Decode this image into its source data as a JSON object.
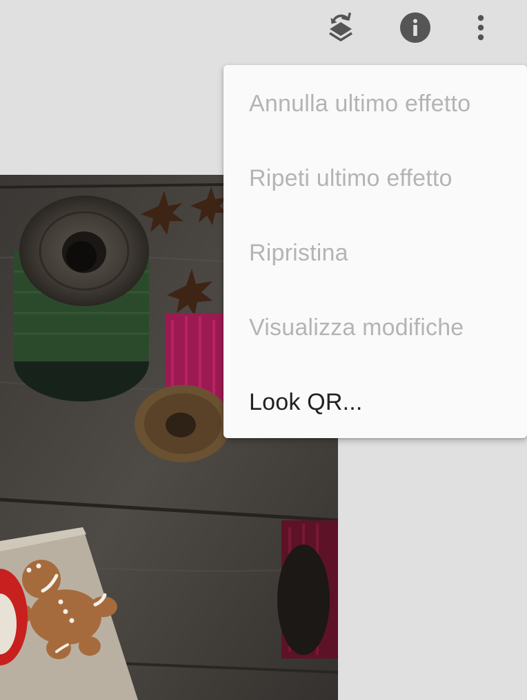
{
  "toolbar": {
    "stacks_icon": "layers-undo-icon",
    "info_icon": "info-icon",
    "more_icon": "more-vert-icon"
  },
  "photo": {
    "subject": "spools of thread, star anise and gingerbread man cookie on a dark wooden table"
  },
  "menu": {
    "items": [
      {
        "label": "Annulla ultimo effetto",
        "enabled": false
      },
      {
        "label": "Ripeti ultimo effetto",
        "enabled": false
      },
      {
        "label": "Ripristina",
        "enabled": false
      },
      {
        "label": "Visualizza modifiche",
        "enabled": false
      },
      {
        "label": "Look QR...",
        "enabled": true
      }
    ]
  },
  "colors": {
    "background": "#e0e0e0",
    "icon": "#555555",
    "menu_bg": "#fafafa",
    "text_disabled": "#b4b4b4",
    "text_enabled": "#212121"
  }
}
